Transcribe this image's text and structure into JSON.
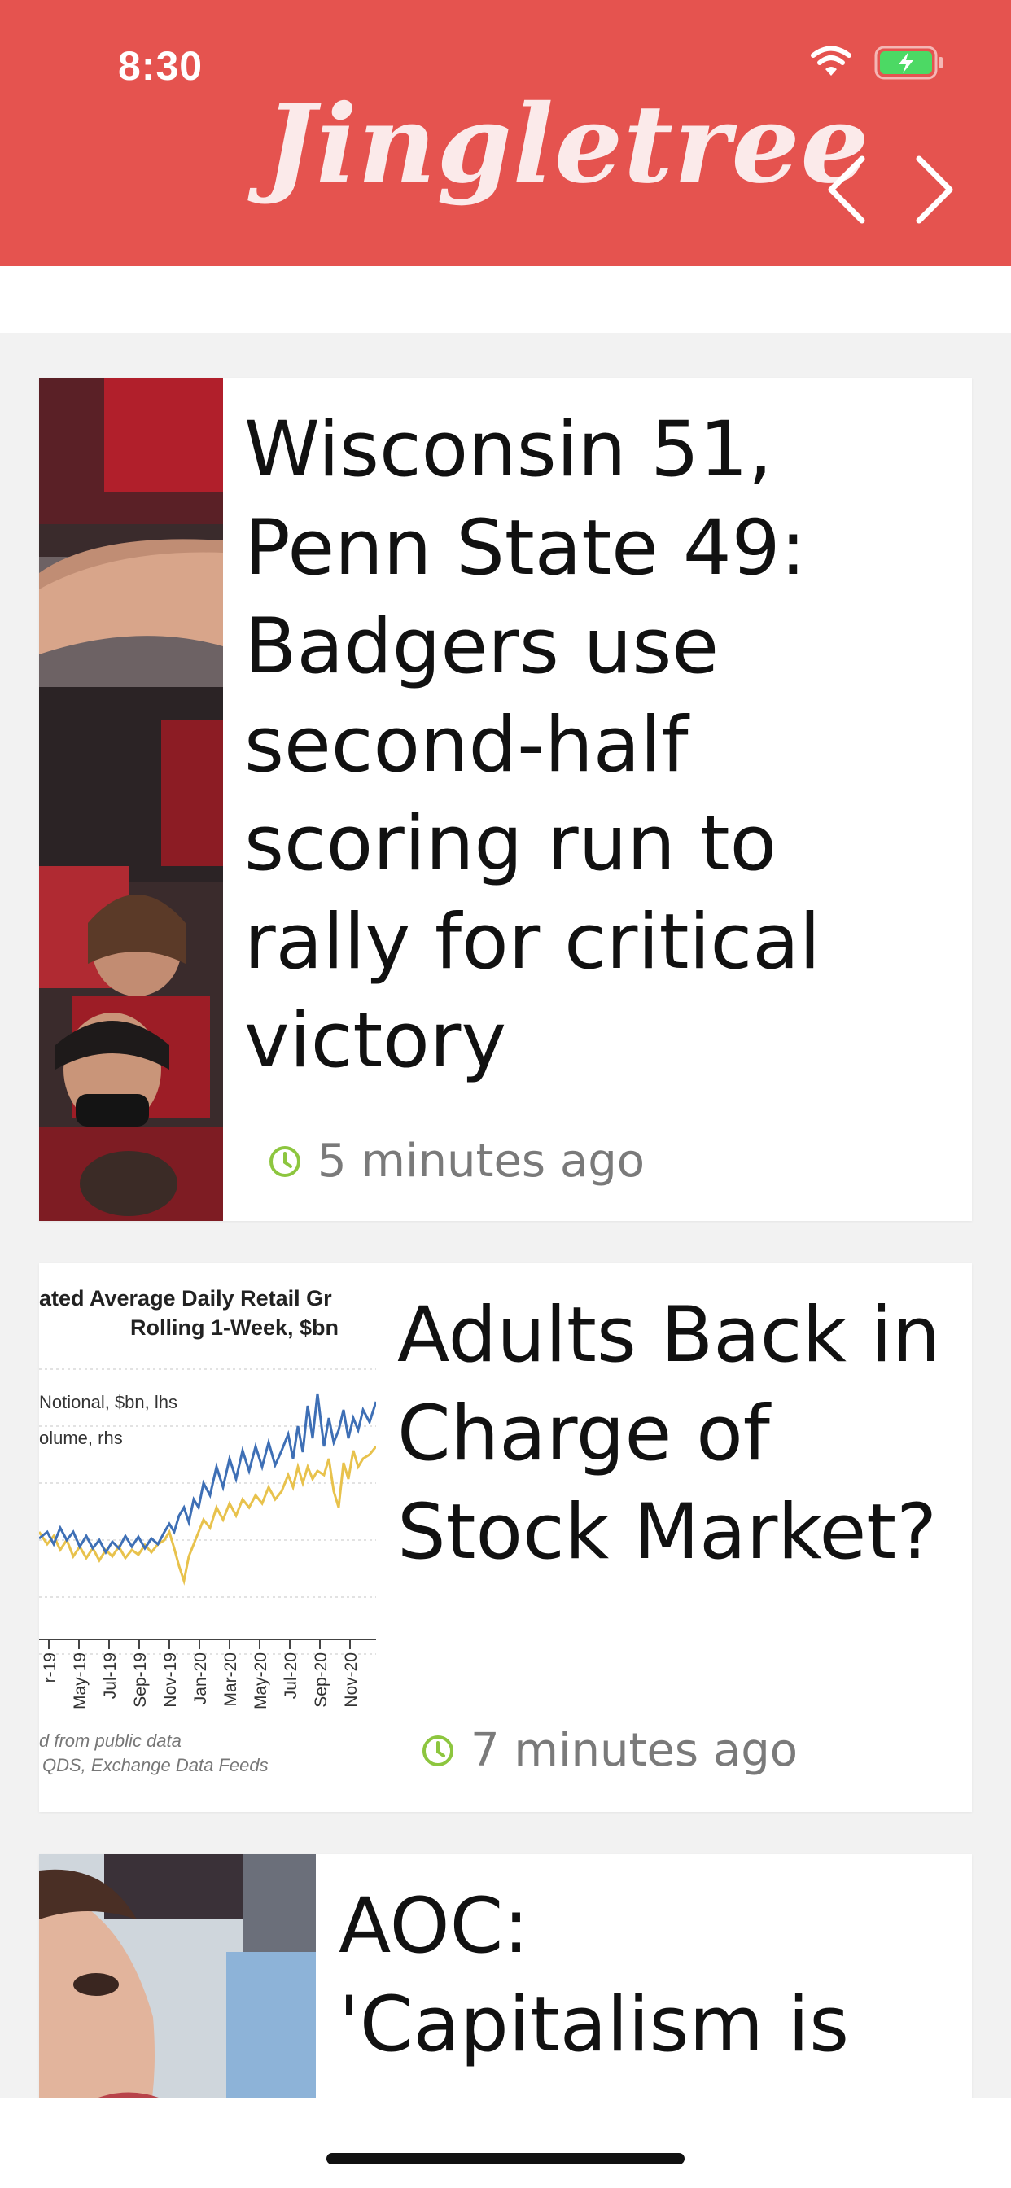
{
  "status_bar": {
    "time": "8:30"
  },
  "header": {
    "brand": "Jingletree",
    "background_color": "#e5534f"
  },
  "nav": {
    "back_icon": "chevron-left-icon",
    "forward_icon": "chevron-right-icon"
  },
  "articles": [
    {
      "headline": "Wisconsin 51, Penn State 49: Badgers use second-half scoring run to rally for critical victory",
      "time_ago": "5 minutes ago"
    },
    {
      "headline": "Adults Back in Charge of Stock Market?",
      "time_ago": "7 minutes ago"
    },
    {
      "headline": "AOC: 'Capitalism is"
    }
  ],
  "thumb_chart": {
    "title_line1": "ated Average Daily Retail Gr",
    "title_line2": "Rolling 1-Week, $bn",
    "legend1": "Notional, $bn, lhs",
    "legend2": "olume, rhs",
    "xticks": [
      "r-19",
      "May-19",
      "Jul-19",
      "Sep-19",
      "Nov-19",
      "Jan-20",
      "Mar-20",
      "May-20",
      "Jul-20",
      "Sep-20",
      "Nov-20"
    ],
    "source1": "d from public data",
    "source2": "QDS, Exchange Data Feeds"
  },
  "colors": {
    "clock_icon": "#8dc63f",
    "series_blue": "#3e6fb5",
    "series_yellow": "#e8c24c"
  }
}
